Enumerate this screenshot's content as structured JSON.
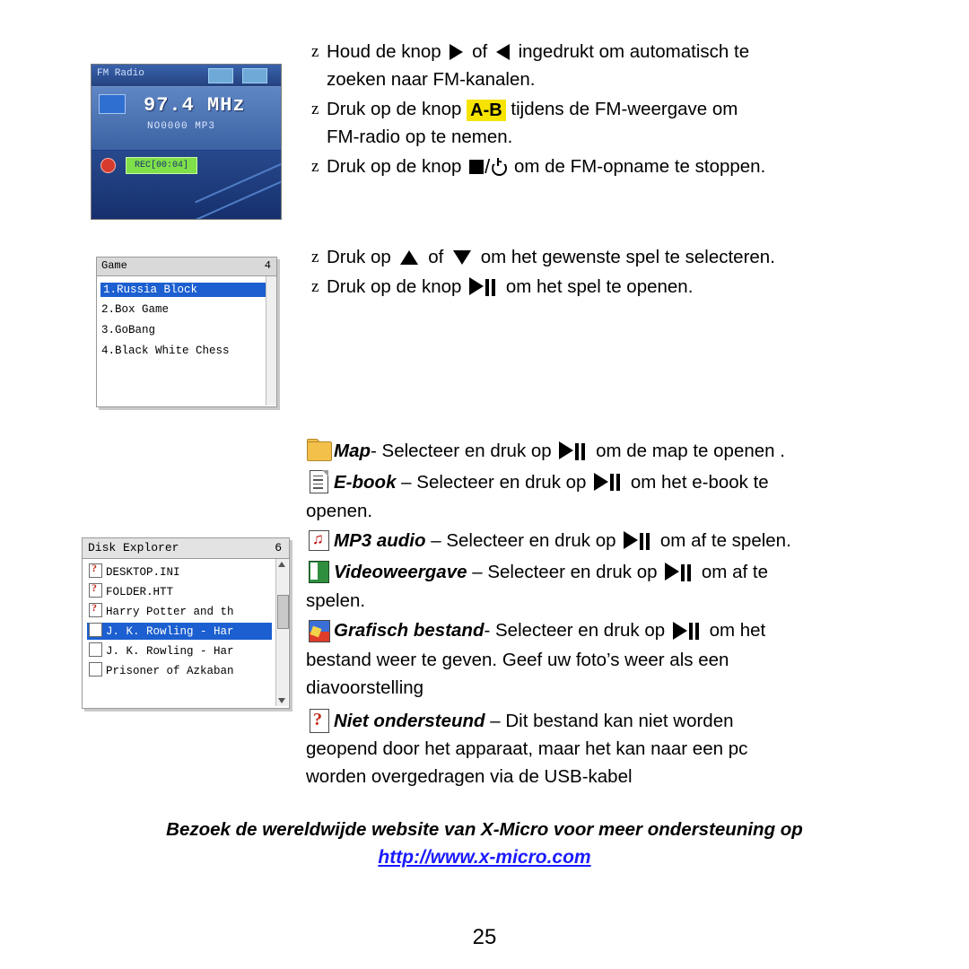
{
  "fm_section": {
    "bullets": [
      {
        "pre": "Houd  de  knop",
        "mid": "of",
        "post": "ingedrukt  om  automatisch  te",
        "line2": "zoeken naar FM-kanalen."
      },
      {
        "pre": "Druk  op  de  knop",
        "key": "A-B",
        "post": "tijdens  de  FM-weergave  om",
        "line2": "FM-radio op te nemen."
      },
      {
        "pre": "Druk op de knop",
        "post": "om de FM-opname te stoppen."
      }
    ]
  },
  "game_section": {
    "bullets": [
      {
        "pre": "Druk op",
        "mid": "of",
        "post": "om het gewenste spel te selecteren."
      },
      {
        "pre": "Druk op de knop",
        "post": "om het spel te openen."
      }
    ]
  },
  "file_types": [
    {
      "icon": "folder-icon",
      "label": "Map",
      "text_before": "- Selecteer en druk op",
      "text_after": "om de map te openen ."
    },
    {
      "icon": "ebook-icon",
      "label": "E-book",
      "text_before": "– Selecteer en druk op",
      "text_after": "om het e-book te",
      "line2": "openen."
    },
    {
      "icon": "mp3-audio-icon",
      "label": "MP3 audio",
      "text_before": "– Selecteer en druk op",
      "text_after": "om af te spelen."
    },
    {
      "icon": "video-icon",
      "label": "Videoweergave",
      "text_before": "– Selecteer en druk op",
      "text_after": "om af te",
      "line2": "spelen."
    },
    {
      "icon": "graphic-file-icon",
      "label": "Grafisch bestand",
      "text_before": "- Selecteer en druk op",
      "text_after": "om het",
      "line2": "bestand weer te geven. Geef uw foto’s weer als een",
      "line3": "diavoorstelling"
    },
    {
      "icon": "unsupported-icon",
      "label": "Niet ondersteund",
      "text_before": "– Dit bestand kan niet worden",
      "text_after": "",
      "line2": "geopend door het apparaat, maar het kan naar een pc",
      "line3": "worden overgedragen via de USB-kabel"
    }
  ],
  "footer": {
    "note": "Bezoek de wereldwijde website van X-Micro voor meer ondersteuning op",
    "link": "http://www.x-micro.com",
    "page_number": "25"
  },
  "fm_screenshot": {
    "title_left": "FM Radio",
    "frequency": "97.4 MHz",
    "sub_label": "NO0000 MP3",
    "rec_label": "REC[00:04]"
  },
  "game_screenshot": {
    "title": "Game",
    "count": "4",
    "items": [
      "1.Russia Block",
      "2.Box Game",
      "3.GoBang",
      "4.Black White Chess"
    ],
    "selected_index": 0
  },
  "disk_screenshot": {
    "title": "Disk Explorer",
    "count": "6",
    "items": [
      "DESKTOP.INI",
      "FOLDER.HTT",
      "Harry Potter and th",
      "J. K. Rowling - Har",
      "J. K. Rowling - Har",
      "Prisoner of Azkaban"
    ],
    "selected_index": 3
  }
}
